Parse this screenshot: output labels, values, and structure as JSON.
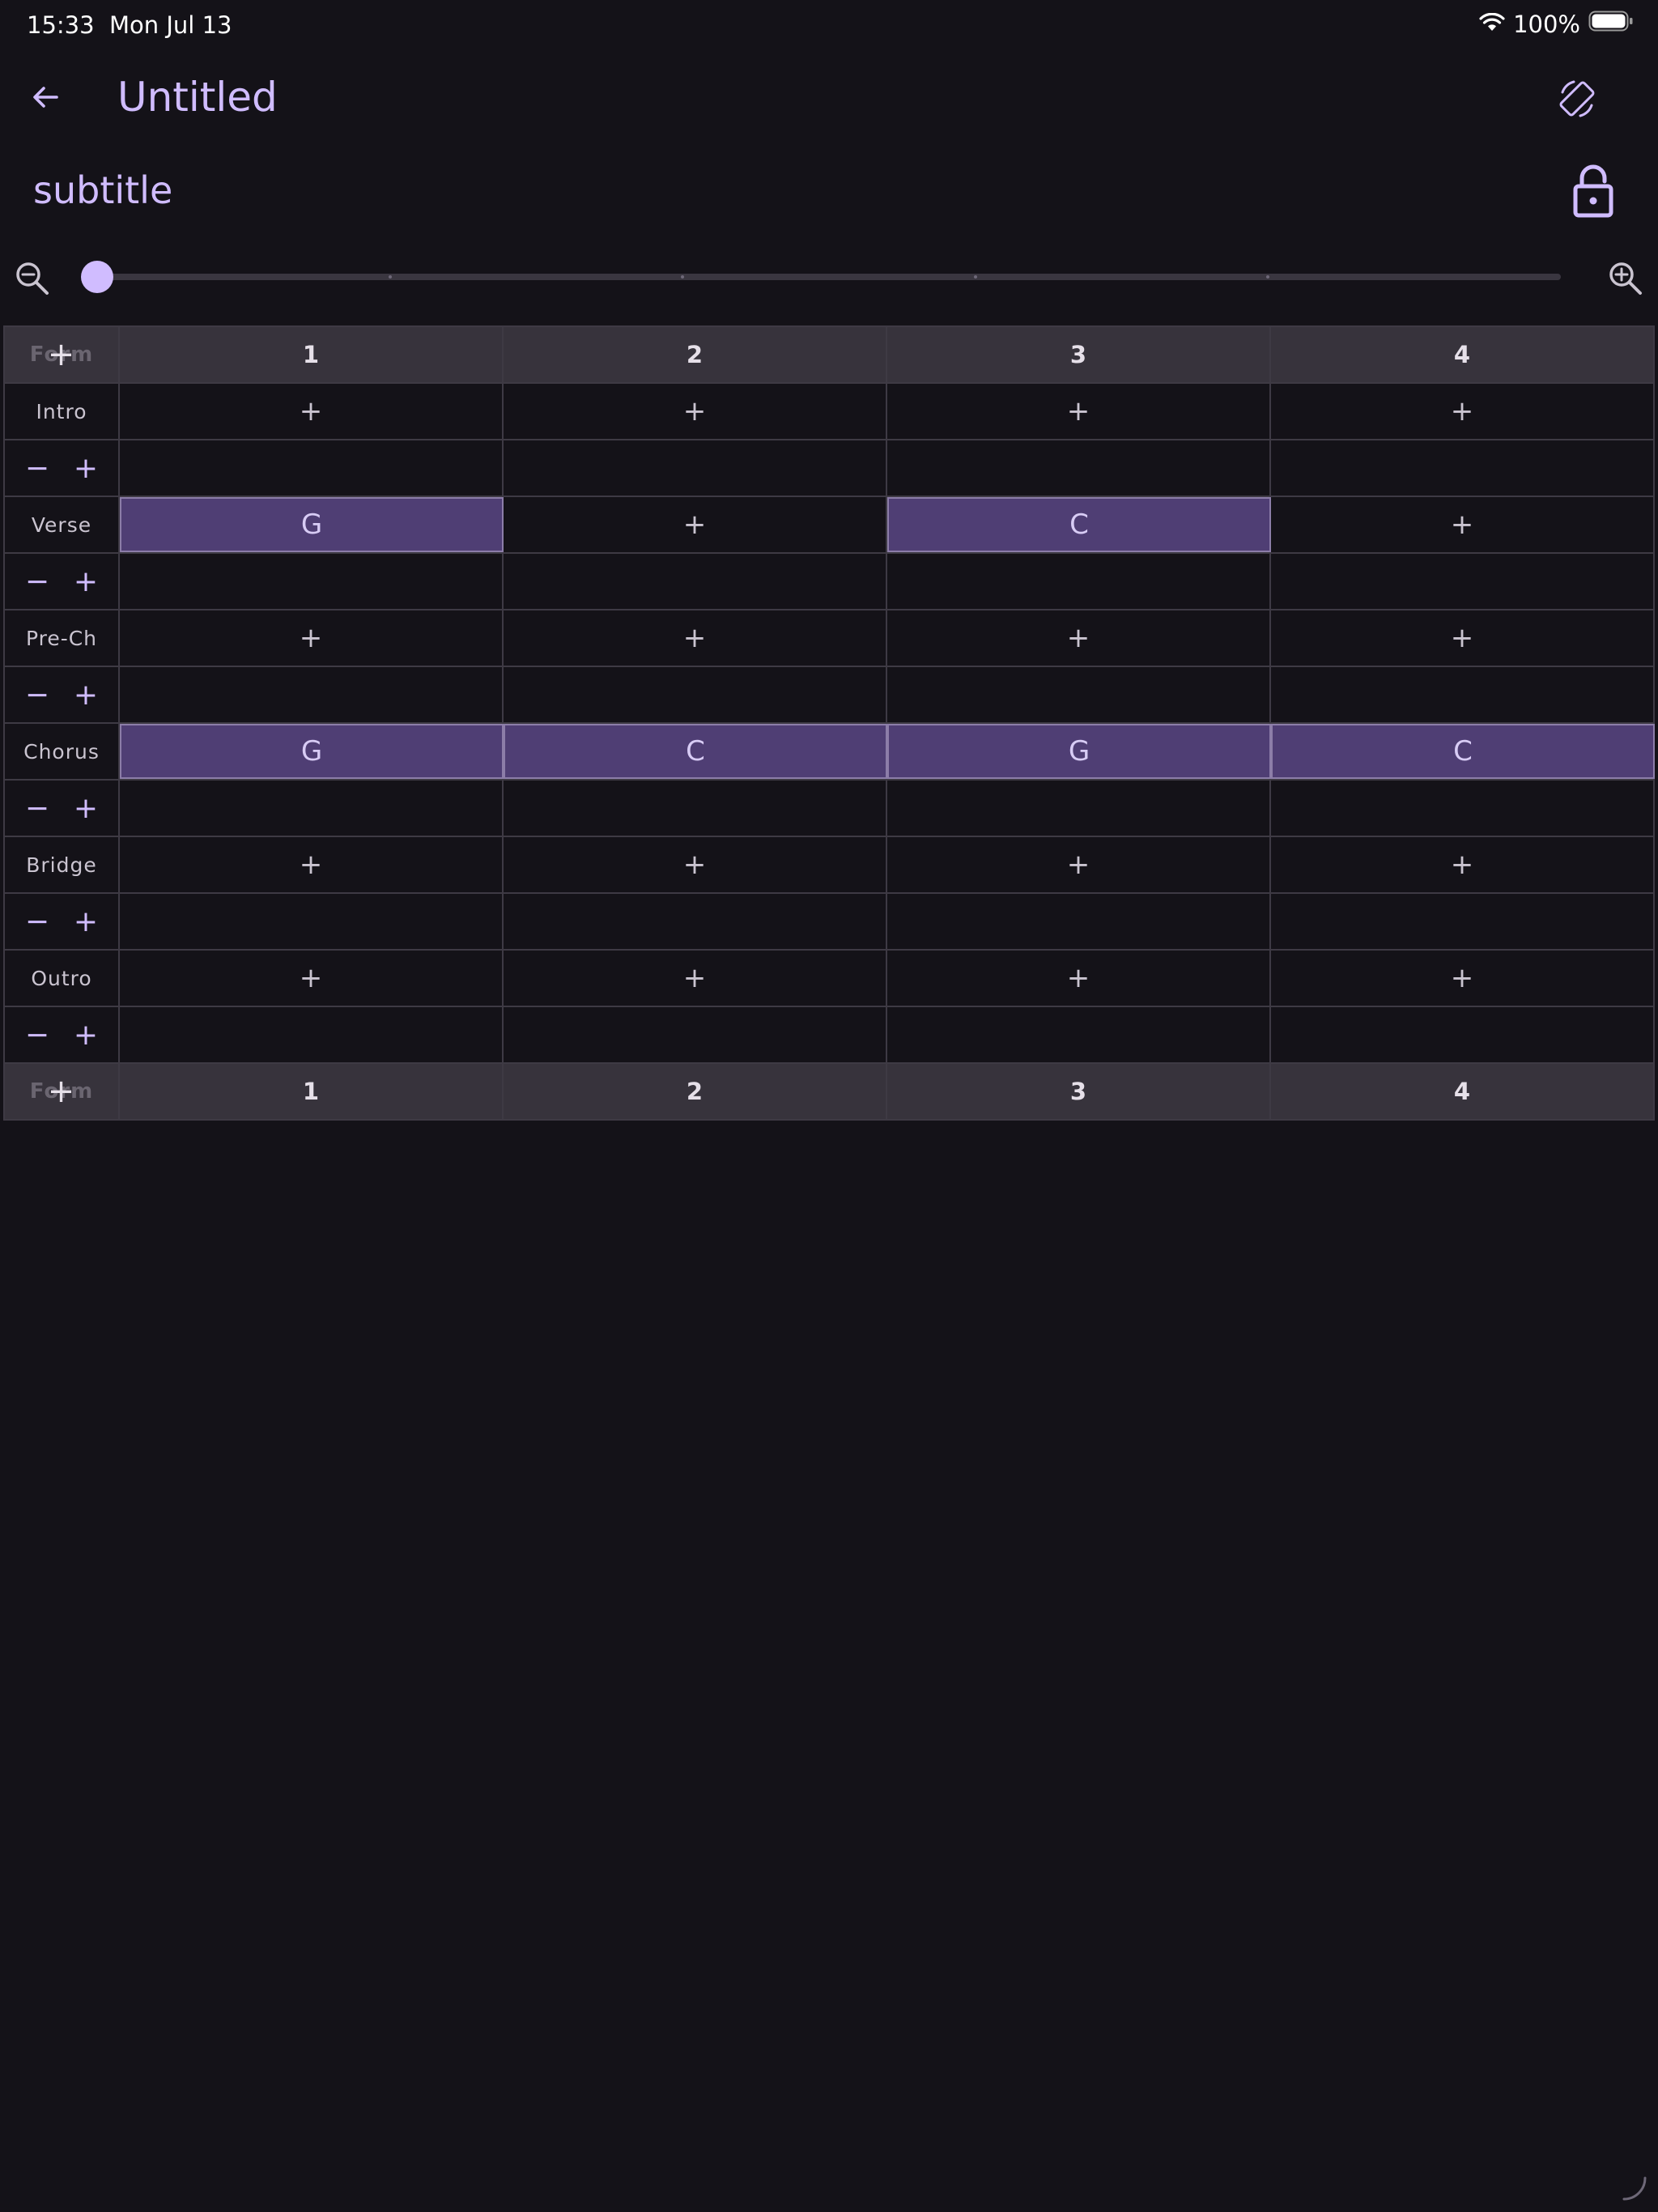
{
  "status_bar": {
    "time": "15:33",
    "date": "Mon Jul 13",
    "battery": "100%"
  },
  "app_bar": {
    "title": "Untitled",
    "subtitle": "subtitle",
    "back_icon": "arrow-left-icon",
    "rotate_icon": "screen-rotation-icon",
    "lock_icon": "unlock-icon"
  },
  "zoom": {
    "level": 0.0,
    "steps": 5
  },
  "grid": {
    "corner_label": "Form",
    "corner_add": "+",
    "columns": [
      "1",
      "2",
      "3",
      "4"
    ],
    "add_glyph": "+",
    "remove_glyph": "−",
    "sections": [
      {
        "name": "Intro",
        "bars": [
          "",
          "",
          "",
          ""
        ]
      },
      {
        "name": "Verse",
        "bars": [
          "G",
          "",
          "C",
          ""
        ]
      },
      {
        "name": "Pre-Ch",
        "bars": [
          "",
          "",
          "",
          ""
        ]
      },
      {
        "name": "Chorus",
        "bars": [
          "G",
          "C",
          "G",
          "C"
        ]
      },
      {
        "name": "Bridge",
        "bars": [
          "",
          "",
          "",
          ""
        ]
      },
      {
        "name": "Outro",
        "bars": [
          "",
          "",
          "",
          ""
        ]
      }
    ]
  },
  "colors": {
    "background": "#141218",
    "accent": "#D0BCFF",
    "chord_fill": "#4F3E74",
    "header_fill": "#37333C"
  }
}
